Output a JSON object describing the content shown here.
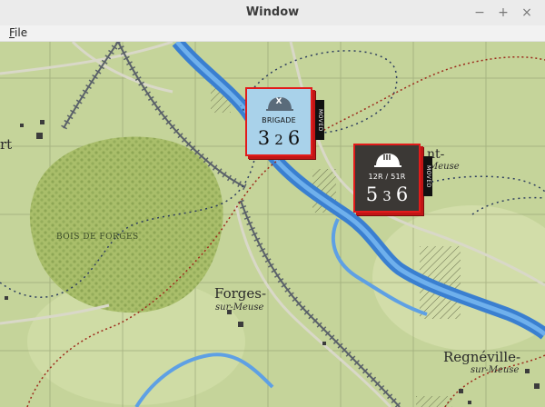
{
  "window": {
    "title": "Window",
    "minimize": "−",
    "maximize": "+",
    "close": "×"
  },
  "menu": {
    "file_mnemonic": "F",
    "file_rest": "ile"
  },
  "map": {
    "labels": {
      "rt": "rt",
      "bois": "BOIS    DE FORGES",
      "nt": "nt-",
      "meuse_top": "Meuse",
      "forges": "Forges-",
      "forges_sub": "sur-Meuse",
      "regneville": "Regnéville-",
      "regneville_sub": "sur-Meuse"
    }
  },
  "counters": [
    {
      "unit_symbol": "X",
      "unit_type": "BRIGADE",
      "attack": "3",
      "range": "2",
      "move": "6",
      "status": "MOVED",
      "colors": {
        "bg": "#a9d2ea",
        "text": "#111111",
        "helmet": "#5a6b7a"
      }
    },
    {
      "unit_symbol": "III",
      "unit_type": "12R / 51R",
      "attack": "5",
      "range": "3",
      "move": "6",
      "status": "MOVED",
      "colors": {
        "bg": "#3b3835",
        "text": "#ffffff",
        "helmet": "#ffffff"
      }
    }
  ]
}
